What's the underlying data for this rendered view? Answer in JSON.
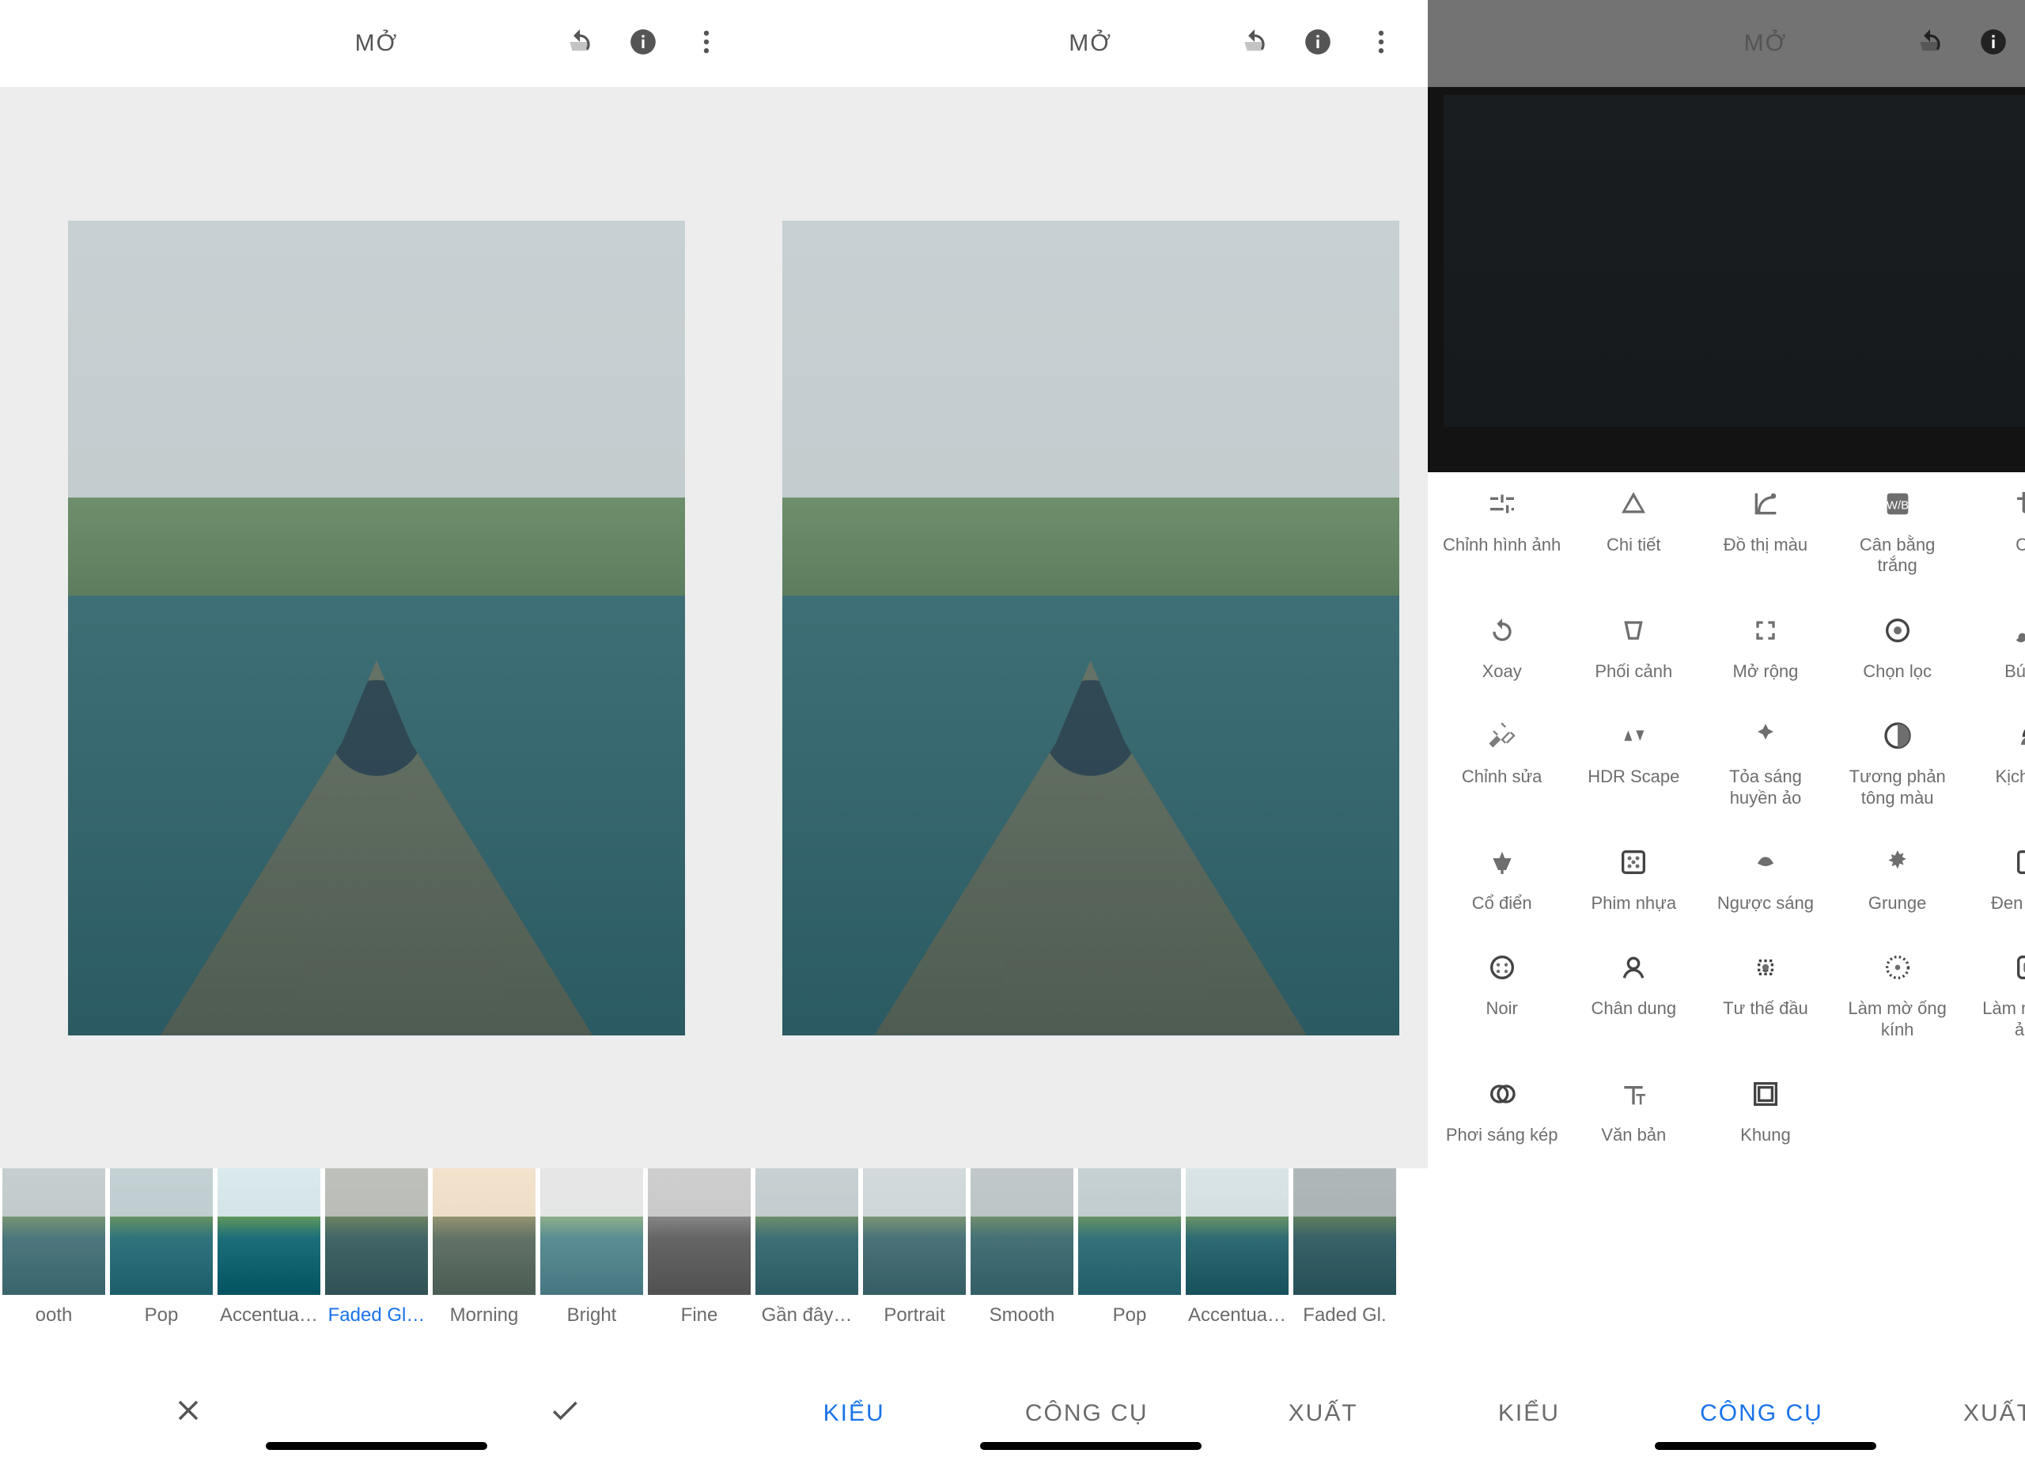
{
  "header": {
    "open_label": "MỞ"
  },
  "nav": {
    "styles": "KIỂU",
    "tools": "CÔNG CỤ",
    "export": "XUẤT"
  },
  "panel1": {
    "active_index": 3,
    "filters": [
      "ooth",
      "Pop",
      "Accentua…",
      "Faded Gl…",
      "Morning",
      "Bright",
      "Fine"
    ]
  },
  "panel2": {
    "filters": [
      "Gần đây…",
      "Portrait",
      "Smooth",
      "Pop",
      "Accentua…",
      "Faded Gl."
    ]
  },
  "tools": [
    {
      "k": "tune",
      "label": "Chỉnh hình ảnh"
    },
    {
      "k": "details",
      "label": "Chi tiết"
    },
    {
      "k": "curves",
      "label": "Đồ thị màu"
    },
    {
      "k": "wb",
      "label": "Cân bằng trắng"
    },
    {
      "k": "crop",
      "label": "Cắt"
    },
    {
      "k": "rotate",
      "label": "Xoay"
    },
    {
      "k": "perspective",
      "label": "Phối cảnh"
    },
    {
      "k": "expand",
      "label": "Mở rộng"
    },
    {
      "k": "selective",
      "label": "Chọn lọc"
    },
    {
      "k": "brush",
      "label": "Bút vẽ"
    },
    {
      "k": "healing",
      "label": "Chỉnh sửa"
    },
    {
      "k": "hdr",
      "label": "HDR Scape"
    },
    {
      "k": "glamour",
      "label": "Tỏa sáng huyền ảo"
    },
    {
      "k": "tonal",
      "label": "Tương phản tông màu"
    },
    {
      "k": "drama",
      "label": "Kịch tính"
    },
    {
      "k": "vintage",
      "label": "Cổ điển"
    },
    {
      "k": "grainy",
      "label": "Phim nhựa"
    },
    {
      "k": "retrolux",
      "label": "Ngược sáng"
    },
    {
      "k": "grunge",
      "label": "Grunge"
    },
    {
      "k": "bw",
      "label": "Đen trắng"
    },
    {
      "k": "noir",
      "label": "Noir"
    },
    {
      "k": "portrait",
      "label": "Chân dung"
    },
    {
      "k": "headpose",
      "label": "Tư thế đầu"
    },
    {
      "k": "lensblur",
      "label": "Làm mờ ống kính"
    },
    {
      "k": "vignette",
      "label": "Làm mờ nét ảnh"
    },
    {
      "k": "double",
      "label": "Phơi sáng kép"
    },
    {
      "k": "text",
      "label": "Văn bản"
    },
    {
      "k": "frames",
      "label": "Khung"
    }
  ]
}
